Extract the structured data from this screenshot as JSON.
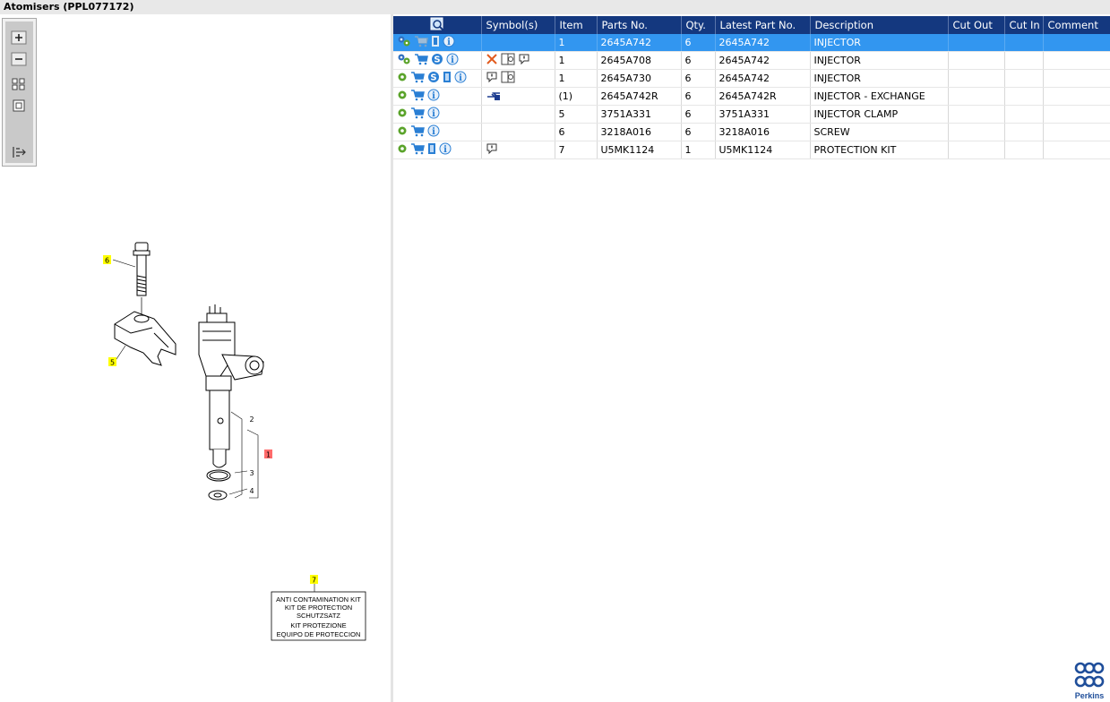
{
  "window": {
    "title": "Atomisers (PPL077172)"
  },
  "toolbar": {
    "buttons": [
      {
        "name": "zoom-in-icon"
      },
      {
        "name": "zoom-out-icon"
      },
      {
        "name": "fit-page-icon"
      },
      {
        "name": "actual-size-icon"
      },
      {
        "name": "expand-panel-icon"
      }
    ]
  },
  "diagram": {
    "callouts": [
      "6",
      "5",
      "2",
      "1",
      "3",
      "4",
      "7"
    ],
    "kit_label": [
      "ANTI CONTAMINATION KIT",
      "KIT DE PROTECTION",
      "SCHUTZSATZ",
      "KIT PROTEZIONE",
      "EQUIPO DE PROTECCION"
    ],
    "highlight_color": "#ffff00",
    "selected_callout_color": "#ff6b6b"
  },
  "table": {
    "headers": [
      "",
      "Symbol(s)",
      "Item",
      "Parts No.",
      "Qty.",
      "Latest Part No.",
      "Description",
      "Cut Out",
      "Cut In",
      "Comment"
    ],
    "rows": [
      {
        "icons": [
          "cogs",
          "cart-grey",
          "doc-grey",
          "info"
        ],
        "symbols": [],
        "item": "1",
        "part": "2645A742",
        "qty": "6",
        "latest": "2645A742",
        "desc": "INJECTOR",
        "cut_out": "",
        "cut_in": "",
        "comment": "",
        "selected": true
      },
      {
        "icons": [
          "cogs",
          "cart",
          "s",
          "info"
        ],
        "symbols": [
          "cross",
          "book",
          "alert"
        ],
        "item": "1",
        "part": "2645A708",
        "qty": "6",
        "latest": "2645A742",
        "desc": "INJECTOR",
        "cut_out": "",
        "cut_in": "",
        "comment": ""
      },
      {
        "icons": [
          "gear",
          "cart",
          "s",
          "doc",
          "info"
        ],
        "symbols": [
          "alert",
          "book"
        ],
        "item": "1",
        "part": "2645A730",
        "qty": "6",
        "latest": "2645A742",
        "desc": "INJECTOR",
        "cut_out": "",
        "cut_in": "",
        "comment": ""
      },
      {
        "icons": [
          "gear",
          "cart",
          "info"
        ],
        "symbols": [
          "exchange"
        ],
        "item": "(1)",
        "part": "2645A742R",
        "qty": "6",
        "latest": "2645A742R",
        "desc": "INJECTOR - EXCHANGE",
        "cut_out": "",
        "cut_in": "",
        "comment": ""
      },
      {
        "icons": [
          "gear",
          "cart",
          "info"
        ],
        "symbols": [],
        "item": "5",
        "part": "3751A331",
        "qty": "6",
        "latest": "3751A331",
        "desc": "INJECTOR CLAMP",
        "cut_out": "",
        "cut_in": "",
        "comment": ""
      },
      {
        "icons": [
          "gear",
          "cart",
          "info"
        ],
        "symbols": [],
        "item": "6",
        "part": "3218A016",
        "qty": "6",
        "latest": "3218A016",
        "desc": "SCREW",
        "cut_out": "",
        "cut_in": "",
        "comment": ""
      },
      {
        "icons": [
          "gear",
          "cart",
          "doc",
          "info"
        ],
        "symbols": [
          "alert"
        ],
        "item": "7",
        "part": "U5MK1124",
        "qty": "1",
        "latest": "U5MK1124",
        "desc": "PROTECTION KIT",
        "cut_out": "",
        "cut_in": "",
        "comment": ""
      }
    ],
    "header_color": "#14387f",
    "selected_color": "#3296f0"
  },
  "brand": {
    "name": "Perkins"
  }
}
